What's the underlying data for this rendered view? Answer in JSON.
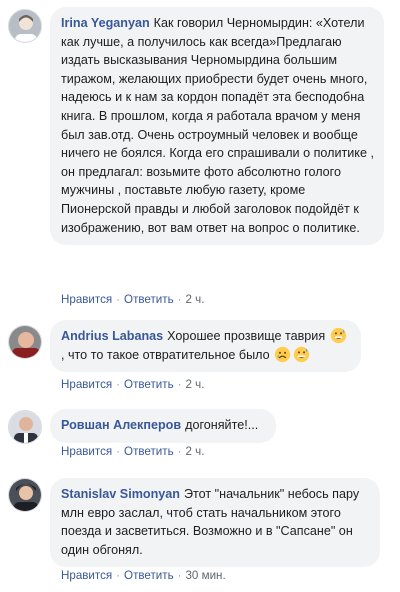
{
  "comments": [
    {
      "author": "Irina Yeganyan",
      "avatar_icon": "profile-photo-user",
      "text": "Как говорил Черномырдин: «Хотели как лучше, а получилось как всегда»Предлагаю издать высказывания Черномырдина большим тиражом, желающих приобрести будет очень много, надеюсь и к нам за кордон попадёт эта бесподобна книга. В прошлом, когда я работала врачом у меня был зав.отд. Очень остроумный человек и вообще ничего не боялся. Когда его спрашивали о политике , он предлагал: возьмите фото абсолютно голого мужчины , поставьте любую газету, кроме Пионерской правды и любой заголовок подойдёт к изображению, вот вам ответ на вопрос о политике.",
      "like": "Нравится",
      "reply": "Ответить",
      "time": "2 ч."
    },
    {
      "author": "Andrius Labanas",
      "avatar_icon": "profile-photo-user",
      "text_before": "Хорошее прозвище таврия",
      "text_middle": ", что то такое отвратительное было",
      "emojis": [
        "grinning-sweat-emoji",
        "sad-tear-emoji",
        "grinning-sweat-emoji"
      ],
      "like": "Нравится",
      "reply": "Ответить",
      "time": "2 ч."
    },
    {
      "author": "Ровшан Алекперов",
      "avatar_icon": "profile-photo-user",
      "text": "догоняйте!...",
      "like": "Нравится",
      "reply": "Ответить",
      "time": "2 ч."
    },
    {
      "author": "Stanislav Simonyan",
      "avatar_icon": "profile-photo-user",
      "text": "Этот \"начальник\" небось пару млн евро заслал, чтоб стать начальником этого поезда и засветиться. Возможно и в \"Сапсане\" он один обгонял.",
      "like": "Нравится",
      "reply": "Ответить",
      "time": "30 мин."
    }
  ],
  "colors": {
    "author": "#385898",
    "bubble": "#f2f3f5",
    "meta": "#606770"
  },
  "separator": "·"
}
